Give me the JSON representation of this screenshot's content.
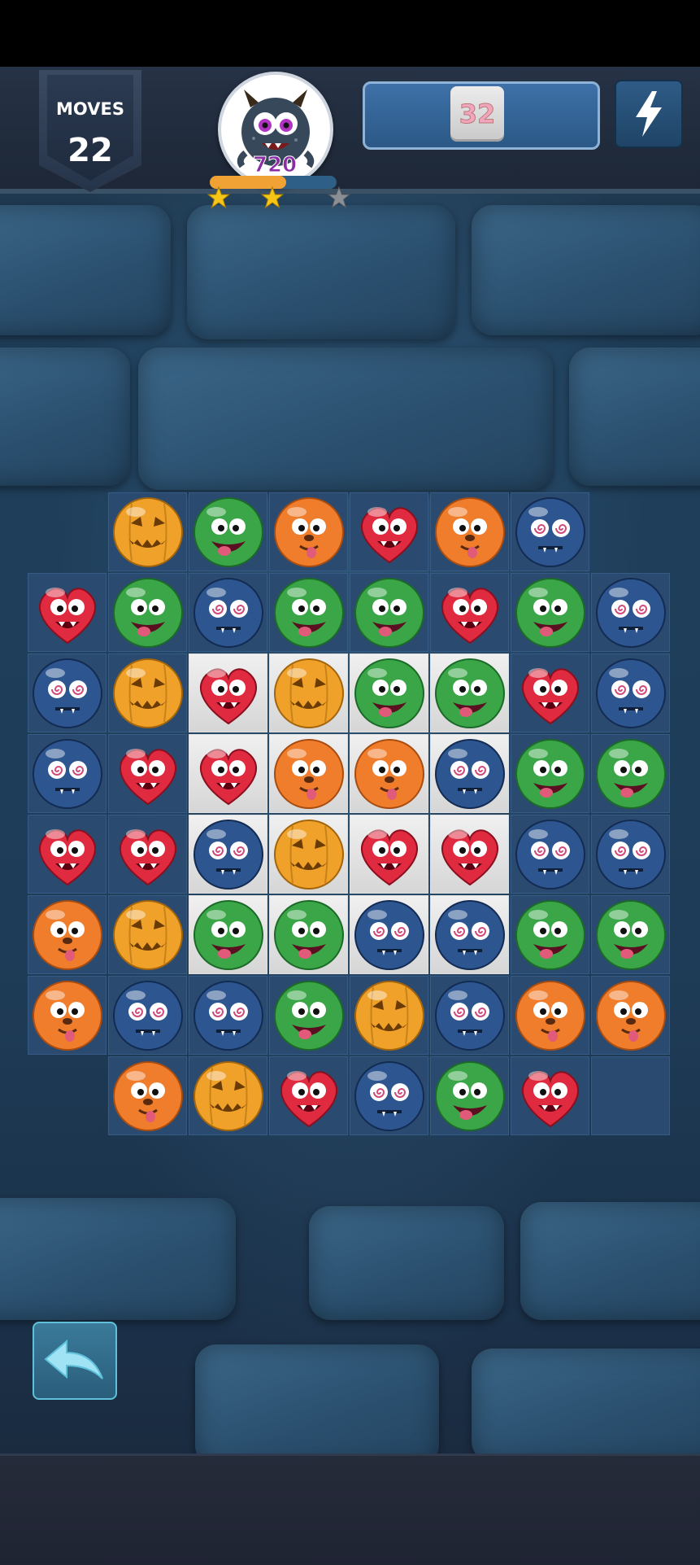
{
  "hud": {
    "moves_label": "MOVES",
    "moves_value": "22",
    "score": "720",
    "target_count": "32",
    "progress_fraction": 0.6,
    "stars_earned": 2,
    "stars_total": 3,
    "boost_icon": "lightning-icon",
    "avatar_icon": "monster-avatar-icon"
  },
  "board": {
    "columns": 8,
    "rows": 8,
    "pieces": {
      "heart": {
        "icon": "red-heart-monster-icon",
        "color": "#e02a3f"
      },
      "pumpkin": {
        "icon": "pumpkin-monster-icon",
        "color": "#f0a129"
      },
      "green": {
        "icon": "green-monster-icon",
        "color": "#3aa648"
      },
      "orange": {
        "icon": "orange-monster-icon",
        "color": "#f07d2c"
      },
      "blue": {
        "icon": "blue-swirl-monster-icon",
        "color": "#2d5690"
      }
    },
    "grid": [
      [
        null,
        "pumpkin",
        "green",
        "orange",
        "heart",
        "orange",
        "blue",
        null
      ],
      [
        "heart",
        "green",
        "blue",
        "green",
        "green",
        "heart",
        "green",
        "blue"
      ],
      [
        "blue",
        "pumpkin",
        "heart",
        "pumpkin",
        "green",
        "green",
        "heart",
        "blue"
      ],
      [
        "blue",
        "heart",
        "heart",
        "orange",
        "orange",
        "blue",
        "green",
        "green"
      ],
      [
        "heart",
        "heart",
        "blue",
        "pumpkin",
        "heart",
        "heart",
        "blue",
        "blue"
      ],
      [
        "orange",
        "pumpkin",
        "green",
        "green",
        "blue",
        "blue",
        "green",
        "green"
      ],
      [
        "orange",
        "blue",
        "blue",
        "green",
        "pumpkin",
        "blue",
        "orange",
        "orange"
      ],
      [
        null,
        "orange",
        "pumpkin",
        "heart",
        "blue",
        "green",
        "heart",
        "empty"
      ]
    ],
    "highlighted": [
      [
        2,
        2
      ],
      [
        2,
        3
      ],
      [
        2,
        4
      ],
      [
        2,
        5
      ],
      [
        3,
        2
      ],
      [
        3,
        3
      ],
      [
        3,
        4
      ],
      [
        3,
        5
      ],
      [
        4,
        2
      ],
      [
        4,
        3
      ],
      [
        4,
        4
      ],
      [
        4,
        5
      ],
      [
        5,
        2
      ],
      [
        5,
        3
      ],
      [
        5,
        4
      ],
      [
        5,
        5
      ]
    ]
  },
  "controls": {
    "back_icon": "undo-arrow-icon"
  }
}
